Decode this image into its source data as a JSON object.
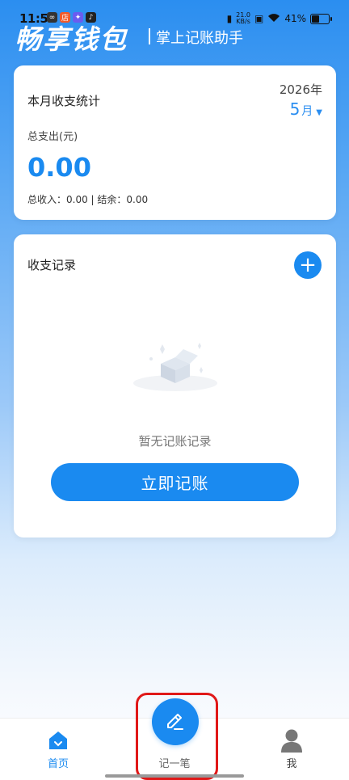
{
  "status_bar": {
    "time": "11:53",
    "net_speed_value": "21.0",
    "net_speed_unit": "KB/s",
    "battery": "41%"
  },
  "header": {
    "app_name": "畅享钱包",
    "subtitle": "掌上记账助手"
  },
  "summary_card": {
    "title": "本月收支统计",
    "year": "2026年",
    "month_number": "5",
    "month_unit": "月",
    "expense_label": "总支出(元)",
    "expense_value": "0.00",
    "income_balance_text": "总收入：0.00 | 结余：0.00"
  },
  "records_card": {
    "title": "收支记录",
    "add_symbol": "+",
    "empty_text": "暂无记账记录",
    "cta_label": "立即记账"
  },
  "bottom_nav": {
    "home_label": "首页",
    "record_label": "记一笔",
    "me_label": "我"
  },
  "colors": {
    "accent": "#1a8af0",
    "highlight": "#e01818"
  }
}
